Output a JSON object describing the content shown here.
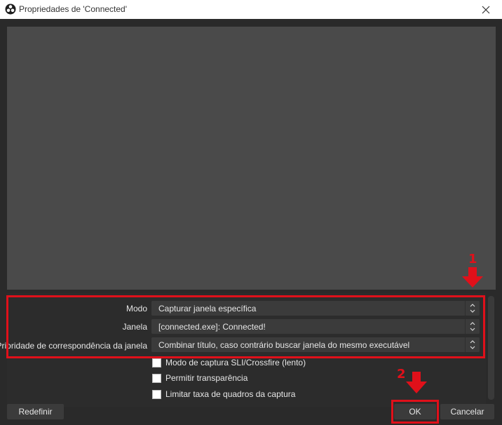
{
  "window": {
    "title": "Propriedades de 'Connected'"
  },
  "properties": {
    "mode": {
      "label": "Modo",
      "value": "Capturar janela específica"
    },
    "window": {
      "label": "Janela",
      "value": "[connected.exe]: Connected!"
    },
    "priority": {
      "label": "Prioridade de correspondência da janela",
      "value": "Combinar título, caso contrário buscar janela do mesmo executável"
    },
    "checkboxes": [
      {
        "label": "Modo de captura SLI/Crossfire (lento)",
        "checked": false
      },
      {
        "label": "Permitir transparência",
        "checked": false
      },
      {
        "label": "Limitar taxa de quadros da captura",
        "checked": false
      }
    ]
  },
  "buttons": {
    "reset": "Redefinir",
    "ok": "OK",
    "cancel": "Cancelar"
  },
  "annotations": {
    "marker1": "1",
    "marker2": "2",
    "color": "#e0101a"
  },
  "icons": [
    "obs-logo-icon",
    "close-icon",
    "combo-arrows-icon",
    "down-arrow-icon"
  ]
}
